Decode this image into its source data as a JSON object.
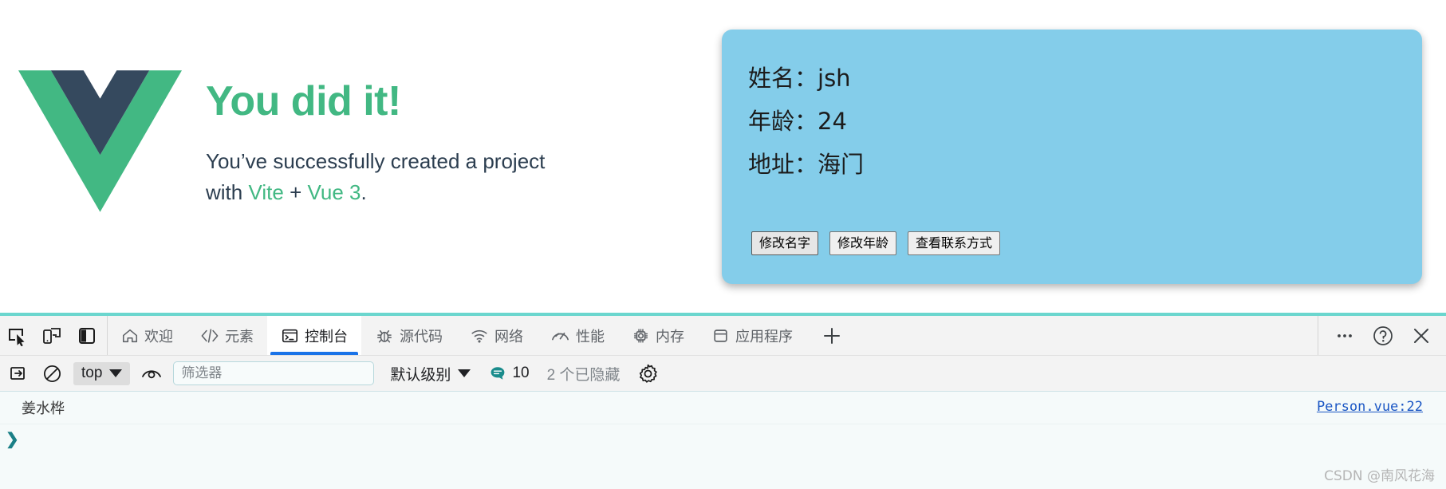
{
  "page": {
    "hero": {
      "title": "You did it!",
      "line1": "You’ve successfully created a project",
      "with": "with",
      "vite": "Vite",
      "plus": "+",
      "vue": "Vue 3",
      "period": ".",
      "logo_green": "#42b883",
      "logo_dark": "#35495e"
    },
    "card": {
      "background": "#84cdea",
      "rows": [
        {
          "label": "姓名：",
          "value": "jsh"
        },
        {
          "label": "年龄：",
          "value": "24"
        },
        {
          "label": "地址：",
          "value": "海门"
        }
      ],
      "buttons": [
        "修改名字",
        "修改年龄",
        "查看联系方式"
      ]
    }
  },
  "devtools": {
    "left_icons": [
      {
        "name": "inspect-element-icon",
        "title": "选择元素"
      },
      {
        "name": "device-toolbar-icon",
        "title": "设备工具栏"
      },
      {
        "name": "dock-side-icon",
        "title": "停靠位置"
      }
    ],
    "tabs": [
      {
        "id": "welcome",
        "label": "欢迎",
        "icon": "home-icon",
        "active": false
      },
      {
        "id": "elements",
        "label": "元素",
        "icon": "code-tags-icon",
        "active": false
      },
      {
        "id": "console",
        "label": "控制台",
        "icon": "terminal-icon",
        "active": true
      },
      {
        "id": "sources",
        "label": "源代码",
        "icon": "bug-icon",
        "active": false
      },
      {
        "id": "network",
        "label": "网络",
        "icon": "wifi-icon",
        "active": false
      },
      {
        "id": "performance",
        "label": "性能",
        "icon": "gauge-icon",
        "active": false
      },
      {
        "id": "memory",
        "label": "内存",
        "icon": "chip-icon",
        "active": false
      },
      {
        "id": "application",
        "label": "应用程序",
        "icon": "storage-icon",
        "active": false
      }
    ],
    "add_tab_label": "+",
    "right_icons": [
      {
        "name": "more-options-icon",
        "label": "…"
      },
      {
        "name": "help-icon",
        "label": "?"
      },
      {
        "name": "close-devtools-icon",
        "label": "✕"
      }
    ],
    "console_toolbar": {
      "clear_console_icon": "clear-console-icon",
      "no_entry_icon": "no-entry-icon",
      "context_value": "top",
      "eye_icon": "live-expression-icon",
      "filter_placeholder": "筛选器",
      "filter_value": "",
      "level_label": "默认级别",
      "message_count": "10",
      "hidden_label": "2 个已隐藏",
      "settings_icon": "gear-icon",
      "accent_blue": "#1a73e8",
      "badge_teal": "#1a7f86"
    },
    "console_body": {
      "messages": [
        {
          "text": "姜水桦",
          "source": "Person.vue:22"
        }
      ],
      "prompt_symbol": "❯"
    },
    "watermark": "CSDN @南风花海"
  }
}
